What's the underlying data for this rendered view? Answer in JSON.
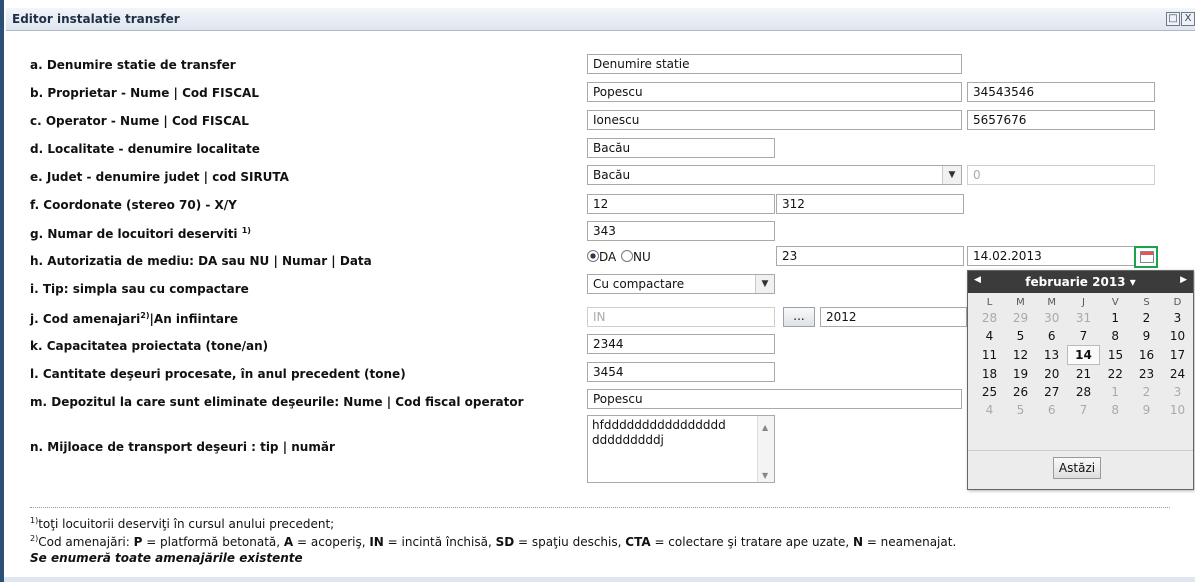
{
  "window": {
    "title": "Editor instalatie transfer",
    "minimize_icon": "□",
    "close_icon": "X"
  },
  "form": {
    "a": {
      "label": "a. Denumire statie de transfer",
      "value": "Denumire statie"
    },
    "b": {
      "label": "b. Proprietar - Nume | Cod FISCAL",
      "name": "Popescu",
      "cod": "34543546"
    },
    "c": {
      "label": "c. Operator - Nume | Cod FISCAL",
      "name": "Ionescu",
      "cod": "5657676"
    },
    "d": {
      "label": "d. Localitate - denumire localitate",
      "value": "Bacău"
    },
    "e": {
      "label": "e. Judet - denumire judet | cod SIRUTA",
      "judet": "Bacău",
      "siruta": "0"
    },
    "f": {
      "label": "f. Coordonate (stereo 70) - X/Y",
      "x": "12",
      "y": "312"
    },
    "g": {
      "label": "g. Numar de locuitori deserviti",
      "sup": "1)",
      "value": "343"
    },
    "h": {
      "label": "h. Autorizatia de mediu: DA sau NU | Numar | Data",
      "da": "DA",
      "nu": "NU",
      "numar": "23",
      "data": "14.02.2013"
    },
    "i": {
      "label": "i. Tip: simpla sau cu compactare",
      "value": "Cu compactare"
    },
    "j": {
      "label_a": "j. Cod amenajari",
      "sup": "2)",
      "label_b": "|An infiintare",
      "cod_placeholder": "IN",
      "btn": "...",
      "an": "2012"
    },
    "k": {
      "label": "k. Capacitatea proiectata (tone/an)",
      "value": "2344"
    },
    "l": {
      "label": "l. Cantitate deşeuri procesate, în anul precedent (tone)",
      "value": "3454"
    },
    "m": {
      "label": "m. Depozitul la care sunt eliminate deşeurile: Nume | Cod fiscal operator",
      "value": "Popescu"
    },
    "n": {
      "label": "n. Mijloace de transport deşeuri : tip | număr",
      "line1": "hfdddddddddddddddd",
      "line2": "dddddddddj"
    }
  },
  "calendar": {
    "month": "februarie 2013",
    "weekdays": [
      "L",
      "M",
      "M",
      "J",
      "V",
      "S",
      "D"
    ],
    "weeks": [
      [
        "28",
        "29",
        "30",
        "31",
        "1",
        "2",
        "3"
      ],
      [
        "4",
        "5",
        "6",
        "7",
        "8",
        "9",
        "10"
      ],
      [
        "11",
        "12",
        "13",
        "14",
        "15",
        "16",
        "17"
      ],
      [
        "18",
        "19",
        "20",
        "21",
        "22",
        "23",
        "24"
      ],
      [
        "25",
        "26",
        "27",
        "28",
        "1",
        "2",
        "3"
      ],
      [
        "4",
        "5",
        "6",
        "7",
        "8",
        "9",
        "10"
      ]
    ],
    "today_label": "Astăzi"
  },
  "footnotes": {
    "n1_sup": "1)",
    "n1": "toţi locuitorii deserviţi în cursul anului precedent;",
    "n2_sup": "2)",
    "n2_pre": "Cod amenajări: ",
    "codes": [
      {
        "k": "P",
        "v": " = platformă betonată, "
      },
      {
        "k": "A",
        "v": " = acoperiş, "
      },
      {
        "k": "IN",
        "v": " = incintă închisă, "
      },
      {
        "k": "SD",
        "v": " = spaţiu deschis, "
      },
      {
        "k": "CTA",
        "v": " = colectare şi tratare ape uzate, "
      },
      {
        "k": "N",
        "v": " = neamenajat."
      }
    ],
    "n3": "Se enumeră toate amenajările existente"
  }
}
